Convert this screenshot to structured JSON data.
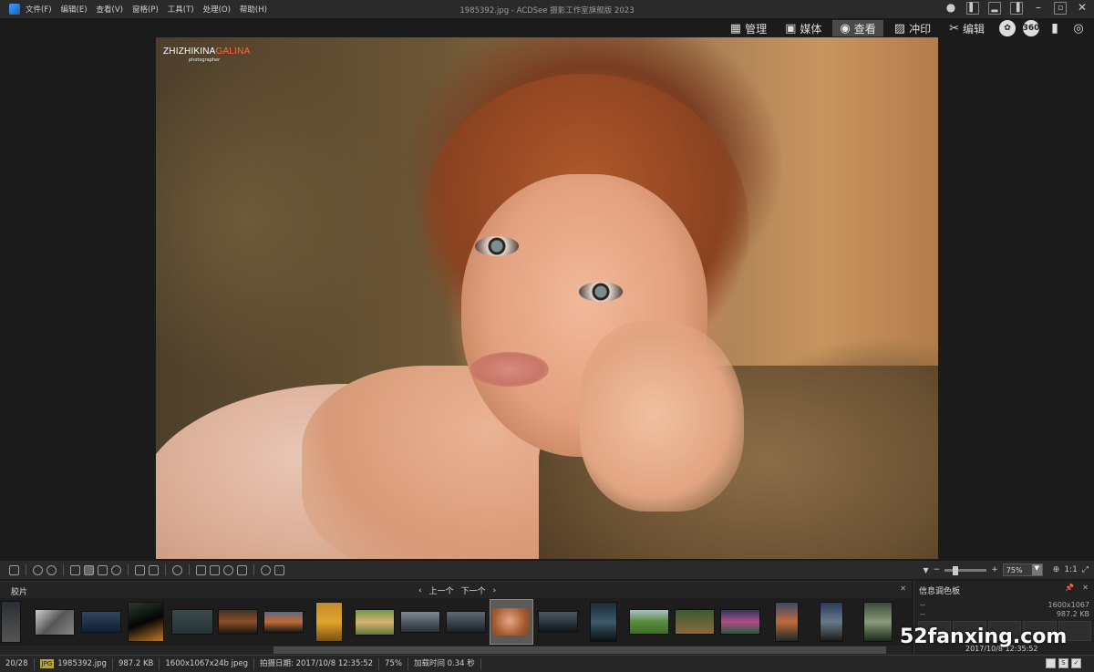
{
  "window": {
    "title": "1985392.jpg - ACDSee 摄影工作室旗舰版 2023"
  },
  "menu": [
    "文件(F)",
    "编辑(E)",
    "查看(V)",
    "窗格(P)",
    "工具(T)",
    "处理(O)",
    "帮助(H)"
  ],
  "modes": [
    {
      "label": "管理",
      "icon": "grid-icon",
      "glyph": "▦"
    },
    {
      "label": "媒体",
      "icon": "media-icon",
      "glyph": "▣"
    },
    {
      "label": "查看",
      "icon": "eye-icon",
      "glyph": "◉"
    },
    {
      "label": "冲印",
      "icon": "develop-icon",
      "glyph": "▨"
    },
    {
      "label": "编辑",
      "icon": "edit-icon",
      "glyph": "✂"
    }
  ],
  "active_mode": "查看",
  "extra_icons": {
    "badge_360": "360"
  },
  "photo": {
    "watermark_main": "ZHIZHIKINA",
    "watermark_accent": "GALINA",
    "watermark_sub": "photographer"
  },
  "toolbar": {
    "zoom_value": "75%",
    "ratio_label": "1:1"
  },
  "filmstrip": {
    "label": "胶片",
    "prev": "上一个",
    "next": "下一个"
  },
  "info_panel": {
    "title": "信息调色板",
    "row1_left": "--",
    "row1_right": "1600x1067",
    "row2_left": "--",
    "row2_right": "987.2 KB",
    "date": "2017/10/8 12:35:52"
  },
  "site_watermark": "52fanxing.com",
  "status": {
    "index": "20/28",
    "format": "JPG",
    "filename": "1985392.jpg",
    "filesize": "987.2 KB",
    "dimensions": "1600x1067x24b jpeg",
    "date_taken": "拍摄日期: 2017/10/8 12:35:52",
    "zoom": "75%",
    "load_time": "加载时间 0.34 秒"
  },
  "colors": {
    "accent": "#ff6a3d",
    "active_tab": "#4a4a4a",
    "background": "#1b1b1b"
  }
}
